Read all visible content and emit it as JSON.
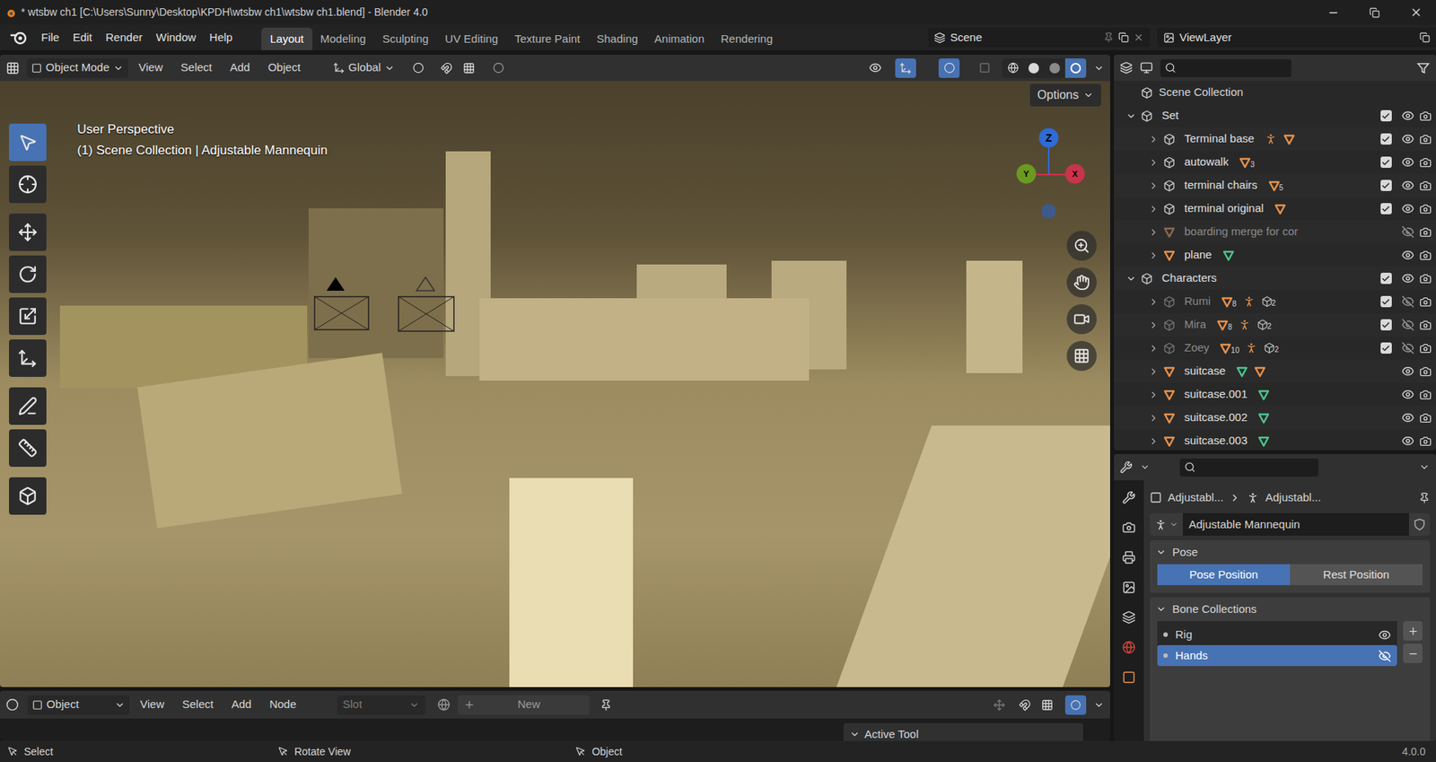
{
  "window": {
    "title": "* wtsbw ch1 [C:\\Users\\Sunny\\Desktop\\KPDH\\wtsbw ch1\\wtsbw ch1.blend] - Blender 4.0"
  },
  "menu": [
    "File",
    "Edit",
    "Render",
    "Window",
    "Help"
  ],
  "workspaces": [
    {
      "label": "Layout",
      "selected": true
    },
    {
      "label": "Modeling",
      "selected": false
    },
    {
      "label": "Sculpting",
      "selected": false
    },
    {
      "label": "UV Editing",
      "selected": false
    },
    {
      "label": "Texture Paint",
      "selected": false
    },
    {
      "label": "Shading",
      "selected": false
    },
    {
      "label": "Animation",
      "selected": false
    },
    {
      "label": "Rendering",
      "selected": false
    }
  ],
  "scene": "Scene",
  "view_layer": "ViewLayer",
  "viewport": {
    "mode": "Object Mode",
    "menu": [
      "View",
      "Select",
      "Add",
      "Object"
    ],
    "orientation": "Global",
    "info": [
      "User Perspective",
      "(1) Scene Collection | Adjustable Mannequin"
    ],
    "options": "Options",
    "tools": [
      {
        "kind": "select",
        "selected": true
      },
      {
        "kind": "cursor",
        "selected": false
      },
      {
        "kind": "move",
        "selected": false
      },
      {
        "kind": "rotate",
        "selected": false
      },
      {
        "kind": "scale",
        "selected": false
      },
      {
        "kind": "transform",
        "selected": false
      },
      {
        "kind": "annotate",
        "selected": false
      },
      {
        "kind": "measure",
        "selected": false
      },
      {
        "kind": "add-cube",
        "selected": false
      }
    ],
    "axes": [
      {
        "label": "Z",
        "color": "#2f6bd6"
      },
      {
        "label": "Y",
        "color": "#6a9a20"
      },
      {
        "label": "X",
        "color": "#c9344c"
      }
    ]
  },
  "outliner": {
    "root": "Scene Collection",
    "rows": [
      {
        "name": "Set",
        "depth": 0,
        "kind": "collection",
        "expanded": true,
        "checked": true,
        "visible": true,
        "disabled": false,
        "badges": []
      },
      {
        "name": "Terminal base",
        "depth": 1,
        "kind": "collection",
        "expanded": false,
        "checked": true,
        "visible": true,
        "disabled": false,
        "badges": [
          {
            "kind": "armature",
            "count": ""
          },
          {
            "kind": "mesh",
            "count": ""
          }
        ]
      },
      {
        "name": "autowalk",
        "depth": 1,
        "kind": "collection",
        "expanded": false,
        "checked": true,
        "visible": true,
        "disabled": false,
        "badges": [
          {
            "kind": "mesh",
            "count": "3"
          }
        ]
      },
      {
        "name": "terminal chairs",
        "depth": 1,
        "kind": "collection",
        "expanded": false,
        "checked": true,
        "visible": true,
        "disabled": false,
        "badges": [
          {
            "kind": "mesh",
            "count": "5"
          }
        ]
      },
      {
        "name": "terminal original",
        "depth": 1,
        "kind": "collection",
        "expanded": false,
        "checked": true,
        "visible": true,
        "disabled": false,
        "badges": [
          {
            "kind": "mesh",
            "count": ""
          }
        ]
      },
      {
        "name": "boarding merge for cor",
        "depth": 1,
        "kind": "object",
        "expanded": false,
        "visible": false,
        "disabled": true,
        "badges": []
      },
      {
        "name": "plane",
        "depth": 1,
        "kind": "object",
        "expanded": false,
        "visible": true,
        "disabled": false,
        "badges": [
          {
            "kind": "data",
            "count": ""
          }
        ]
      },
      {
        "name": "Characters",
        "depth": 0,
        "kind": "collection",
        "expanded": true,
        "checked": true,
        "visible": true,
        "disabled": false,
        "badges": []
      },
      {
        "name": "Rumi",
        "depth": 1,
        "kind": "collection",
        "expanded": false,
        "checked": true,
        "visible": false,
        "disabled": true,
        "badges": [
          {
            "kind": "mesh",
            "count": "8"
          },
          {
            "kind": "armature",
            "count": ""
          },
          {
            "kind": "collection",
            "count": "2"
          }
        ]
      },
      {
        "name": "Mira",
        "depth": 1,
        "kind": "collection",
        "expanded": false,
        "checked": true,
        "visible": false,
        "disabled": true,
        "badges": [
          {
            "kind": "mesh",
            "count": "8"
          },
          {
            "kind": "armature",
            "count": ""
          },
          {
            "kind": "collection",
            "count": "2"
          }
        ]
      },
      {
        "name": "Zoey",
        "depth": 1,
        "kind": "collection",
        "expanded": false,
        "checked": true,
        "visible": false,
        "disabled": true,
        "badges": [
          {
            "kind": "mesh",
            "count": "10"
          },
          {
            "kind": "armature",
            "count": ""
          },
          {
            "kind": "collection",
            "count": "2"
          }
        ]
      },
      {
        "name": "suitcase",
        "depth": 1,
        "kind": "object",
        "expanded": false,
        "visible": true,
        "disabled": false,
        "badges": [
          {
            "kind": "data",
            "count": ""
          },
          {
            "kind": "mesh",
            "count": ""
          }
        ]
      },
      {
        "name": "suitcase.001",
        "depth": 1,
        "kind": "object",
        "expanded": false,
        "visible": true,
        "disabled": false,
        "badges": [
          {
            "kind": "data",
            "count": ""
          }
        ]
      },
      {
        "name": "suitcase.002",
        "depth": 1,
        "kind": "object",
        "expanded": false,
        "visible": true,
        "disabled": false,
        "badges": [
          {
            "kind": "data",
            "count": ""
          }
        ]
      },
      {
        "name": "suitcase.003",
        "depth": 1,
        "kind": "object",
        "expanded": false,
        "visible": true,
        "disabled": false,
        "badges": [
          {
            "kind": "data",
            "count": ""
          }
        ]
      }
    ]
  },
  "properties": {
    "breadcrumb": [
      "Adjustabl...",
      "Adjustabl..."
    ],
    "data_name": "Adjustable Mannequin",
    "tabs": [
      {
        "kind": "tool",
        "selected": false
      },
      {
        "kind": "render",
        "selected": false
      },
      {
        "kind": "output",
        "selected": false
      },
      {
        "kind": "view-layer",
        "selected": false
      },
      {
        "kind": "scene",
        "selected": false
      },
      {
        "kind": "world",
        "selected": false
      },
      {
        "kind": "object",
        "selected": false
      }
    ],
    "pose": {
      "title": "Pose",
      "options": [
        {
          "label": "Pose Position",
          "selected": true
        },
        {
          "label": "Rest Position",
          "selected": false
        }
      ]
    },
    "bone_collections": {
      "title": "Bone Collections",
      "items": [
        {
          "name": "Rig",
          "selected": false,
          "visible": true
        },
        {
          "name": "Hands",
          "selected": true,
          "visible": false
        }
      ]
    }
  },
  "shader": {
    "editor_type": "Object",
    "menu": [
      "View",
      "Select",
      "Add",
      "Node"
    ],
    "slot": "Slot",
    "new": "New",
    "panel": "Active Tool"
  },
  "status_bar": {
    "items": [
      "Select",
      "Rotate View",
      "Object"
    ],
    "version": "4.0.0"
  }
}
